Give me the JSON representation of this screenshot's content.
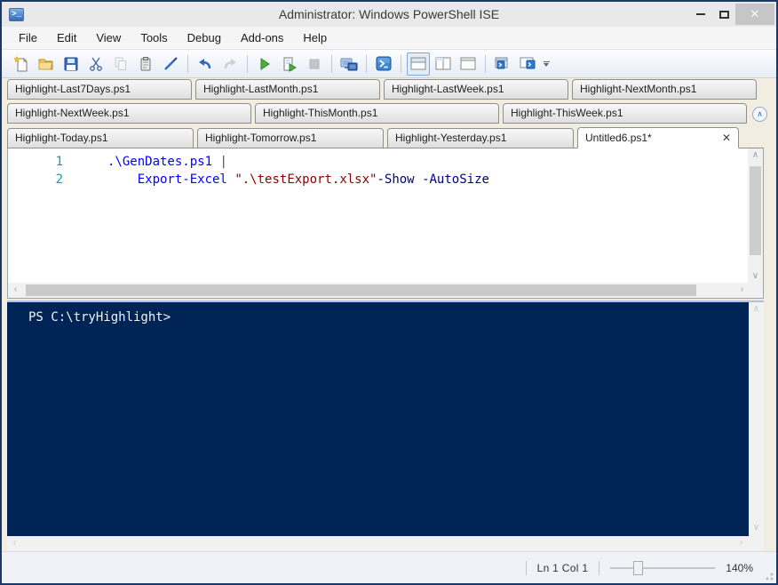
{
  "window": {
    "title": "Administrator: Windows PowerShell ISE"
  },
  "menu": {
    "items": [
      "File",
      "Edit",
      "View",
      "Tools",
      "Debug",
      "Add-ons",
      "Help"
    ]
  },
  "tabs": {
    "rows": [
      [
        "Highlight-Last7Days.ps1",
        "Highlight-LastMonth.ps1",
        "Highlight-LastWeek.ps1",
        "Highlight-NextMonth.ps1"
      ],
      [
        "Highlight-NextWeek.ps1",
        "Highlight-ThisMonth.ps1",
        "Highlight-ThisWeek.ps1"
      ],
      [
        "Highlight-Today.ps1",
        "Highlight-Tomorrow.ps1",
        "Highlight-Yesterday.ps1"
      ]
    ],
    "active": {
      "label": "Untitled6.ps1*",
      "close_glyph": "✕"
    }
  },
  "editor": {
    "lines": [
      {
        "number": "1",
        "segments": [
          {
            "text": ".\\GenDates.ps1 ",
            "type": "command"
          },
          {
            "text": "|",
            "type": "operator"
          }
        ]
      },
      {
        "number": "2",
        "segments": [
          {
            "text": "    ",
            "type": "plain"
          },
          {
            "text": "Export-Excel",
            "type": "command"
          },
          {
            "text": " ",
            "type": "plain"
          },
          {
            "text": "\".\\testExport.xlsx\"",
            "type": "string"
          },
          {
            "text": "-Show",
            "type": "parameter"
          },
          {
            "text": " ",
            "type": "plain"
          },
          {
            "text": "-AutoSize",
            "type": "parameter"
          }
        ]
      }
    ]
  },
  "console": {
    "prompt": "PS C:\\tryHighlight>"
  },
  "statusbar": {
    "position": "Ln 1 Col 1",
    "zoom_level": "140%"
  },
  "colors": {
    "console_bg": "#012456",
    "command": "#0000FF",
    "string": "#8B0000",
    "parameter": "#000080",
    "line_number": "#2B91AF",
    "window_border": "#1C3966"
  }
}
